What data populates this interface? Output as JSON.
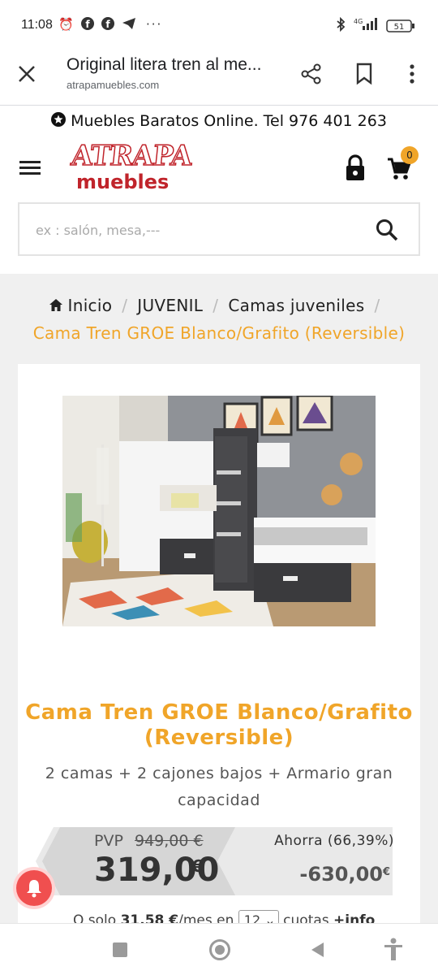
{
  "status_bar": {
    "time": "11:08",
    "network": "4G",
    "battery": "51"
  },
  "tab_bar": {
    "title": "Original litera tren al me...",
    "url": "atrapamuebles.com"
  },
  "promo_banner": {
    "text": "Muebles Baratos Online. Tel 976 401 263"
  },
  "header": {
    "logo_top": "ATRAPA",
    "logo_bottom": "muebles",
    "cart_count": "0"
  },
  "search": {
    "placeholder": "ex : salón, mesa,---"
  },
  "breadcrumb": {
    "home": "Inicio",
    "item1": "JUVENIL",
    "item2": "Camas juveniles",
    "current": "Cama Tren GROE Blanco/Grafito (Reversible)"
  },
  "product": {
    "title": "Cama Tren GROE Blanco/Grafito (Reversible)",
    "subtitle": "2 camas + 2 cajones bajos + Armario gran capacidad",
    "pvp_label": "PVP",
    "old_price": "949,00 €",
    "price": "319,00",
    "price_currency": "€",
    "savings_label": "Ahorra (66,39%)",
    "savings_amount": "-630,00",
    "savings_currency": "€",
    "finance_prefix": "O solo",
    "finance_amount": "31,58 €",
    "finance_per": "/mes en",
    "finance_months": "12",
    "finance_suffix": "cuotas",
    "finance_more": "+info"
  },
  "colors": {
    "accent_orange": "#f0a529",
    "brand_red": "#c0242b",
    "notification_red": "#f04f4f"
  }
}
